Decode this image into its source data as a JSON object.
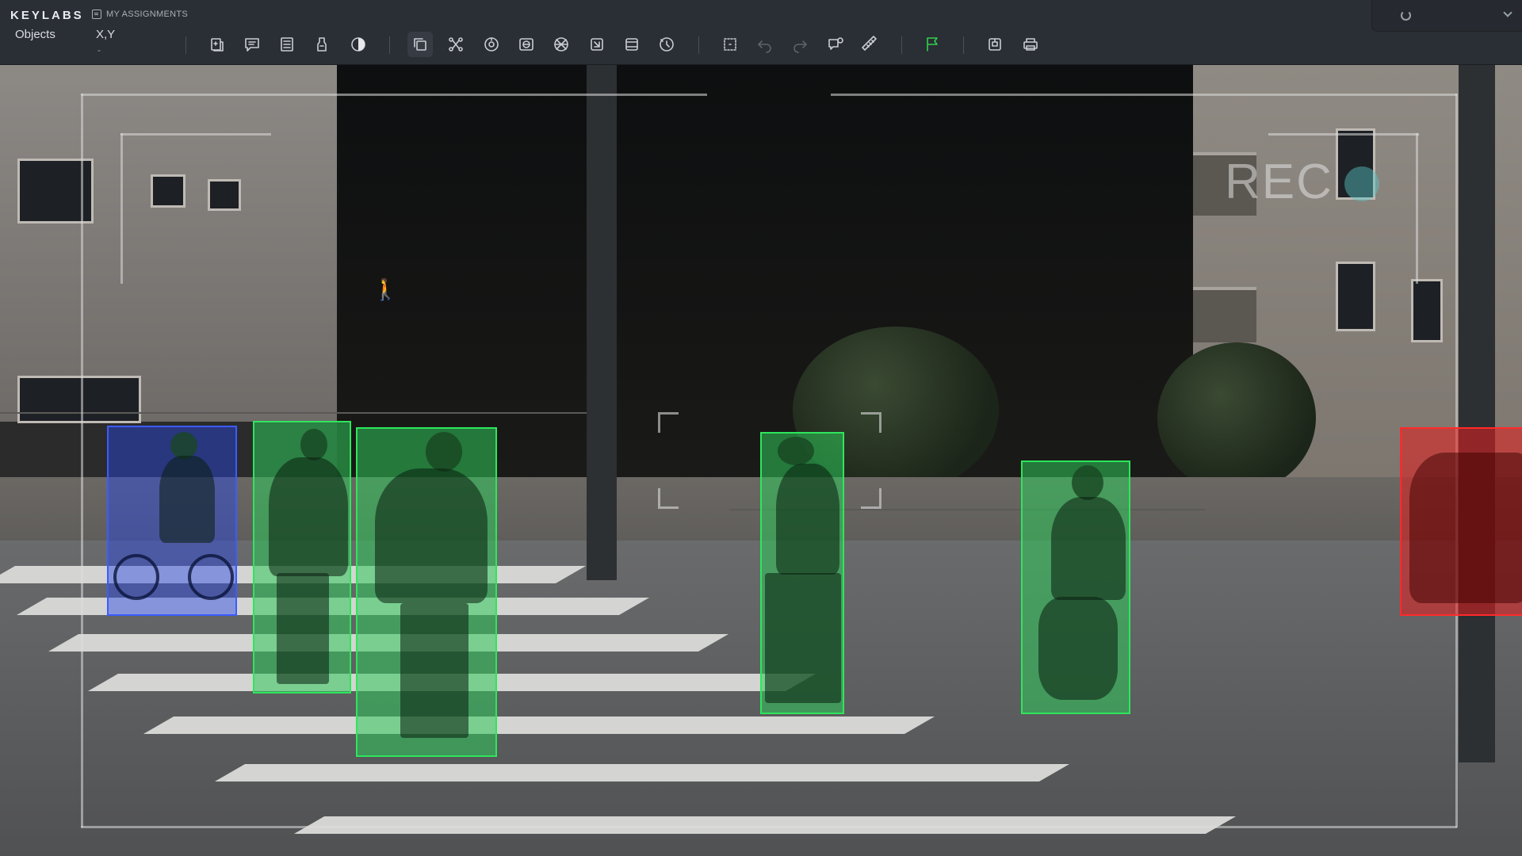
{
  "app": {
    "brand": "KEYLABS",
    "assignments_label": "MY ASSIGNMENTS"
  },
  "tabs": {
    "objects": "Objects",
    "xy": "X,Y",
    "xy_value": "-"
  },
  "toolbar": [
    {
      "name": "add-object-tool-icon"
    },
    {
      "name": "comment-tool-icon"
    },
    {
      "name": "list-tool-icon"
    },
    {
      "name": "marker-tool-icon"
    },
    {
      "name": "contrast-tool-icon"
    },
    {
      "name": "copy-frame-tool-icon"
    },
    {
      "name": "polygon-tool-icon"
    },
    {
      "name": "ellipse-tool-icon"
    },
    {
      "name": "mask-tool-icon"
    },
    {
      "name": "grid-tool-icon"
    },
    {
      "name": "crop-tool-icon"
    },
    {
      "name": "frame-tool-icon"
    },
    {
      "name": "timer-tool-icon"
    },
    {
      "name": "select-area-tool-icon"
    },
    {
      "name": "undo-icon"
    },
    {
      "name": "redo-icon"
    },
    {
      "name": "annotation-comment-icon"
    },
    {
      "name": "ruler-icon"
    },
    {
      "name": "flag-icon"
    },
    {
      "name": "save-icon"
    },
    {
      "name": "print-icon"
    }
  ],
  "overlay": {
    "rec_label": "REC"
  },
  "annotations": [
    {
      "label": "bicycle",
      "color": "#3b5cff"
    },
    {
      "label": "person",
      "color": "#2ee65c"
    },
    {
      "label": "person",
      "color": "#2ee65c"
    },
    {
      "label": "person",
      "color": "#2ee65c"
    },
    {
      "label": "person",
      "color": "#2ee65c"
    },
    {
      "label": "car",
      "color": "#ff2a2a"
    }
  ]
}
